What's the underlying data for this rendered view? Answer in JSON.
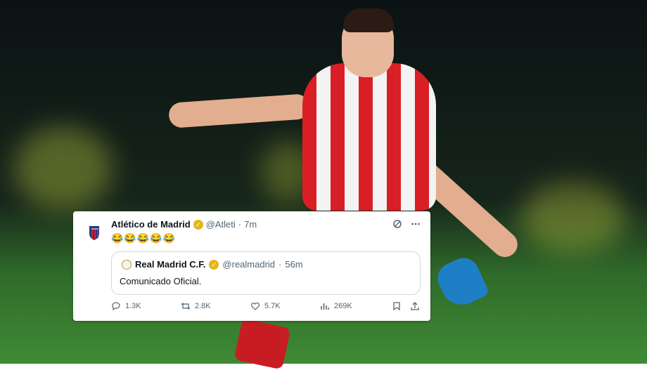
{
  "tweet": {
    "author_name": "Atlético de Madrid",
    "handle": "@Atleti",
    "separator": "·",
    "time": "7m",
    "emoji_text": "😂😂😂😂😂",
    "quoted": {
      "author_name": "Real Madrid C.F.",
      "handle": "@realmadrid",
      "separator": "·",
      "time": "56m",
      "text": "Comunicado Oficial."
    },
    "stats": {
      "replies": "1.3K",
      "retweets": "2.8K",
      "likes": "5.7K",
      "views": "269K"
    }
  },
  "icons": {
    "reply": "reply-icon",
    "retweet": "retweet-icon",
    "like": "heart-icon",
    "views": "views-icon",
    "bookmark": "bookmark-icon",
    "share": "share-icon",
    "more": "more-icon",
    "grok": "grok-icon"
  },
  "colors": {
    "atletico_red": "#d91f26",
    "verified_gold": "#e2b719",
    "text_secondary": "#536471"
  }
}
